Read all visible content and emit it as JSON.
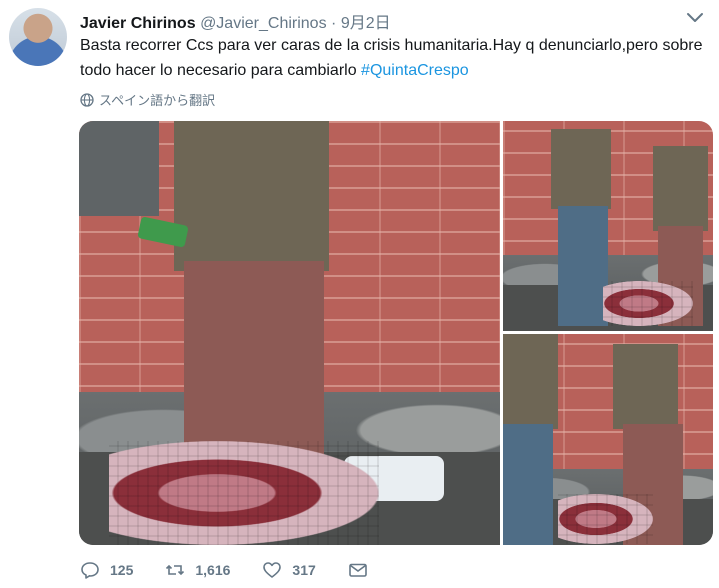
{
  "tweet": {
    "author_name": "Javier Chirinos",
    "author_handle": "@Javier_Chirinos",
    "separator": "·",
    "date": "9月2日",
    "text_main": "Basta recorrer Ccs para ver caras de la crisis humanitaria.Hay q denunciarlo,pero sobre todo hacer lo necesario para cambiarlo ",
    "hashtag": "#QuintaCrespo",
    "translate_label": "スペイン語から翻訳",
    "counts": {
      "replies": "125",
      "retweets": "1,616",
      "likes": "317"
    }
  },
  "icons": {
    "menu": "chevron-down-icon",
    "translate": "globe-icon",
    "reply": "reply-icon",
    "retweet": "retweet-icon",
    "like": "heart-icon",
    "message": "envelope-icon"
  },
  "colors": {
    "text": "#14171a",
    "secondary": "#657786",
    "link": "#1b95e0"
  }
}
